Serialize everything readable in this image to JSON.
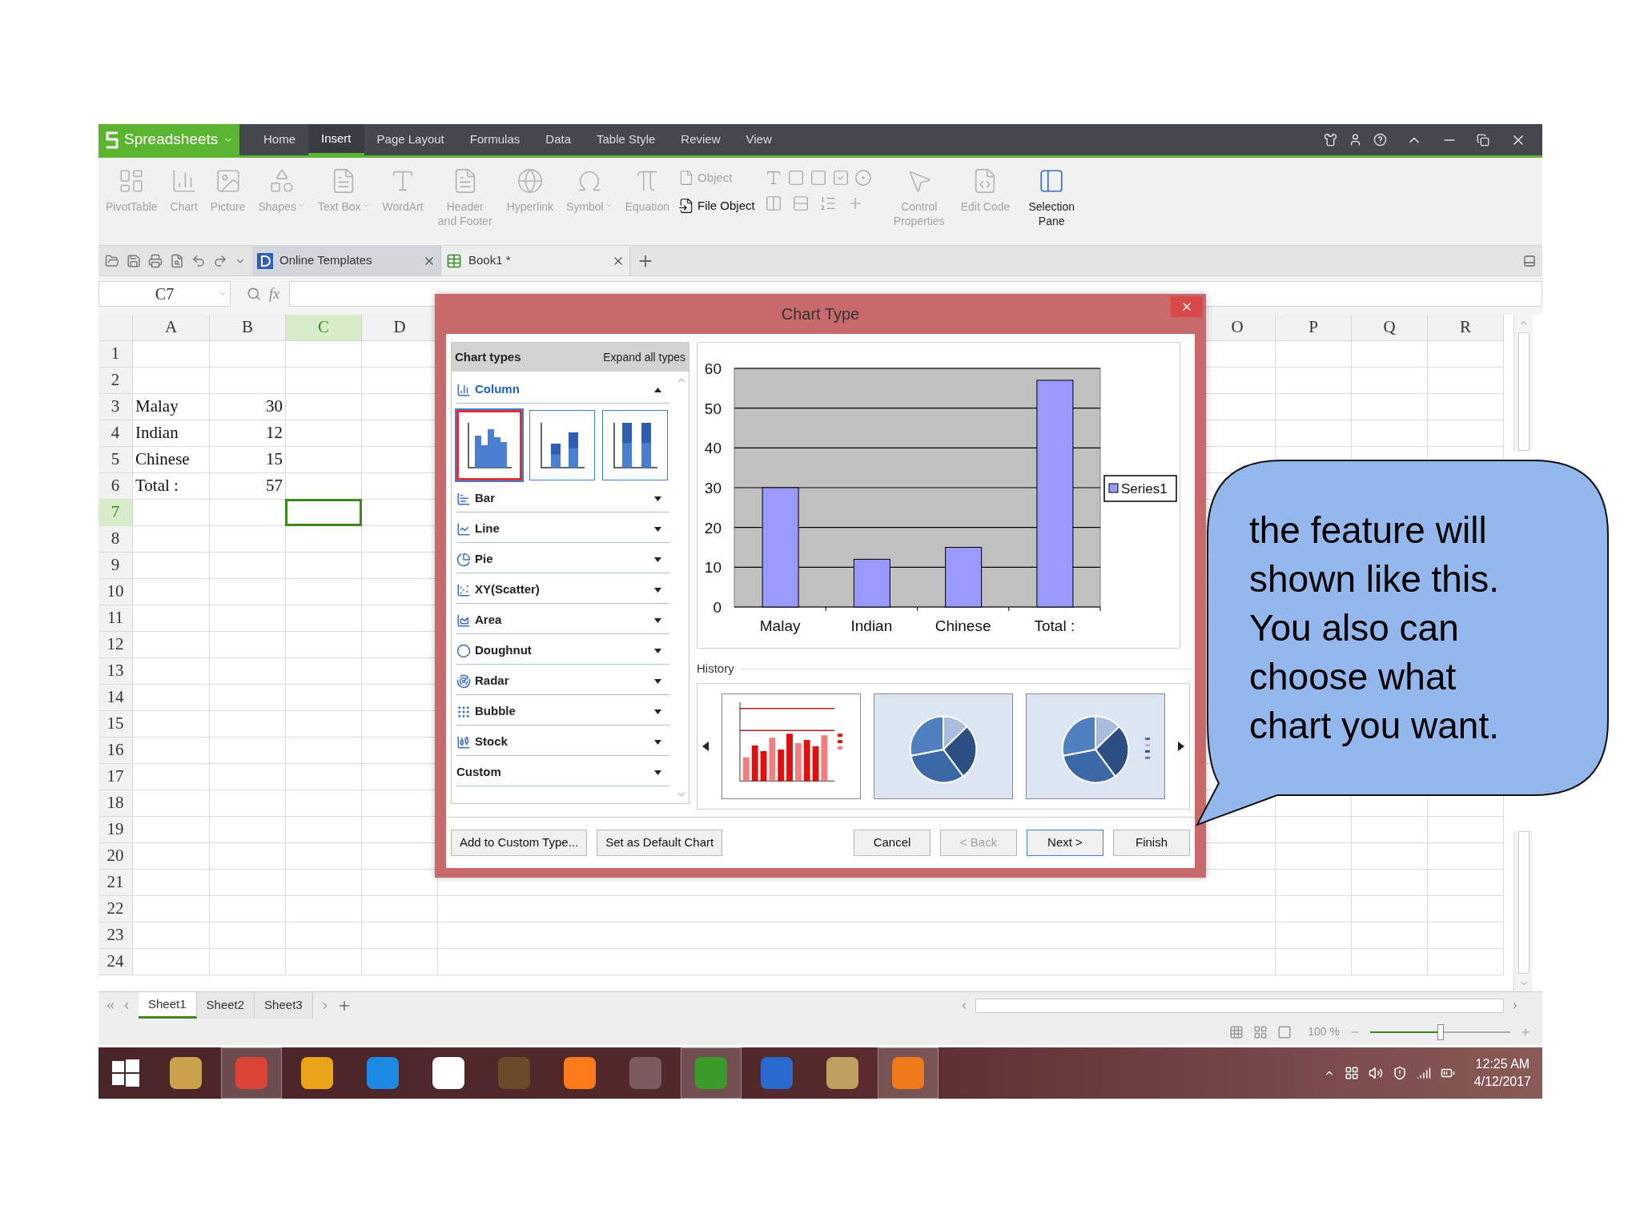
{
  "app": {
    "name": "Spreadsheets"
  },
  "menu_tabs": [
    {
      "label": "Home",
      "selected": false
    },
    {
      "label": "Insert",
      "selected": true
    },
    {
      "label": "Page Layout",
      "selected": false
    },
    {
      "label": "Formulas",
      "selected": false
    },
    {
      "label": "Data",
      "selected": false
    },
    {
      "label": "Table Style",
      "selected": false
    },
    {
      "label": "Review",
      "selected": false
    },
    {
      "label": "View",
      "selected": false
    }
  ],
  "ribbon": {
    "buttons": [
      {
        "label": "PivotTable",
        "disabled": true,
        "has_menu": false
      },
      {
        "label": "Chart",
        "disabled": true,
        "has_menu": false
      },
      {
        "label": "Picture",
        "disabled": true,
        "has_menu": false
      },
      {
        "label": "Shapes",
        "disabled": true,
        "has_menu": true
      },
      {
        "label": "Text Box",
        "disabled": true,
        "has_menu": true
      },
      {
        "label": "WordArt",
        "disabled": true,
        "has_menu": false
      },
      {
        "label": "Header and Footer",
        "disabled": true,
        "has_menu": false
      },
      {
        "label": "Hyperlink",
        "disabled": true,
        "has_menu": false
      },
      {
        "label": "Symbol",
        "disabled": true,
        "has_menu": true
      },
      {
        "label": "Equation",
        "disabled": true,
        "has_menu": false
      }
    ],
    "object_buttons": [
      {
        "label": "Object",
        "disabled": true
      },
      {
        "label": "File Object",
        "disabled": false
      }
    ],
    "control_buttons": [
      {
        "label": "Control Properties",
        "disabled": true
      },
      {
        "label": "Edit Code",
        "disabled": true
      },
      {
        "label": "Selection Pane",
        "disabled": false
      }
    ]
  },
  "doc_tabs": [
    {
      "label": "Online Templates",
      "selected": false
    },
    {
      "label": "Book1 *",
      "selected": true
    }
  ],
  "sheet": {
    "name_box": "C7",
    "formula_label": "fx",
    "columns": [
      {
        "label": "A",
        "selected": false
      },
      {
        "label": "B",
        "selected": false
      },
      {
        "label": "C",
        "selected": true
      },
      {
        "label": "D",
        "selected": false
      },
      {
        "label": "O",
        "selected": false
      },
      {
        "label": "P",
        "selected": false
      },
      {
        "label": "Q",
        "selected": false
      },
      {
        "label": "R",
        "selected": false
      }
    ],
    "rows": [
      {
        "header": "1",
        "selected": false
      },
      {
        "header": "2",
        "selected": false
      },
      {
        "header": "3",
        "selected": false,
        "cells": [
          "Malay",
          "30"
        ]
      },
      {
        "header": "4",
        "selected": false,
        "cells": [
          "Indian",
          "12"
        ]
      },
      {
        "header": "5",
        "selected": false,
        "cells": [
          "Chinese",
          "15"
        ]
      },
      {
        "header": "6",
        "selected": false,
        "cells": [
          "Total :",
          "57"
        ]
      },
      {
        "header": "7",
        "selected": true
      },
      {
        "header": "8",
        "selected": false
      },
      {
        "header": "9",
        "selected": false
      },
      {
        "header": "10",
        "selected": false
      },
      {
        "header": "11",
        "selected": false
      },
      {
        "header": "12",
        "selected": false
      },
      {
        "header": "13",
        "selected": false
      },
      {
        "header": "14",
        "selected": false
      },
      {
        "header": "15",
        "selected": false
      },
      {
        "header": "16",
        "selected": false
      },
      {
        "header": "17",
        "selected": false
      },
      {
        "header": "18",
        "selected": false
      },
      {
        "header": "19",
        "selected": false
      },
      {
        "header": "20",
        "selected": false
      },
      {
        "header": "21",
        "selected": false
      },
      {
        "header": "22",
        "selected": false
      },
      {
        "header": "23",
        "selected": false
      },
      {
        "header": "24",
        "selected": false
      }
    ]
  },
  "sheet_tabs": [
    {
      "label": "Sheet1",
      "selected": true
    },
    {
      "label": "Sheet2",
      "selected": false
    },
    {
      "label": "Sheet3",
      "selected": false
    }
  ],
  "zoom": {
    "label": "100 %",
    "level": 0.5
  },
  "taskbar": {
    "apps": [
      {
        "running": false
      },
      {
        "running": true
      },
      {
        "running": false
      },
      {
        "running": false
      },
      {
        "running": false
      },
      {
        "running": false
      },
      {
        "running": false
      },
      {
        "running": false
      },
      {
        "running": true
      },
      {
        "running": false
      },
      {
        "running": false
      },
      {
        "running": true
      }
    ],
    "time": "12:25 AM",
    "date": "4/12/2017"
  },
  "dialog": {
    "title": "Chart Type",
    "types_header": "Chart types",
    "expand_all": "Expand all types",
    "chart_types": [
      {
        "label": "Column",
        "expanded": true,
        "subtypes": [
          {
            "kind": "clustered",
            "selected": true
          },
          {
            "kind": "stacked",
            "selected": false
          },
          {
            "kind": "percent",
            "selected": false
          }
        ]
      },
      {
        "label": "Bar",
        "expanded": false
      },
      {
        "label": "Line",
        "expanded": false
      },
      {
        "label": "Pie",
        "expanded": false
      },
      {
        "label": "XY(Scatter)",
        "expanded": false
      },
      {
        "label": "Area",
        "expanded": false
      },
      {
        "label": "Doughnut",
        "expanded": false
      },
      {
        "label": "Radar",
        "expanded": false
      },
      {
        "label": "Bubble",
        "expanded": false
      },
      {
        "label": "Stock",
        "expanded": false
      },
      {
        "label": "Custom",
        "expanded": false
      }
    ],
    "preview": {
      "last_category_suffix": ":",
      "chart_data": {
        "type": "bar",
        "categories": [
          "Malay",
          "Indian",
          "Chinese",
          "Total"
        ],
        "series": [
          {
            "name": "Series1",
            "color": "#9999ff",
            "values": [
              30,
              12,
              15,
              57
            ]
          }
        ],
        "ylim": [
          0,
          60
        ],
        "grid": true,
        "yticks": [
          0,
          10,
          20,
          30,
          40,
          50,
          60
        ]
      }
    },
    "history": {
      "label": "History",
      "items": [
        {
          "kind": "bar"
        },
        {
          "kind": "pie"
        },
        {
          "kind": "pie_legend"
        }
      ]
    },
    "buttons": [
      {
        "label": "Add to Custom Type...",
        "disabled": false,
        "default": false
      },
      {
        "label": "Set as Default Chart",
        "disabled": false,
        "default": false
      },
      {
        "label": "Cancel",
        "disabled": false,
        "default": false
      },
      {
        "label": "< Back",
        "disabled": true,
        "default": false
      },
      {
        "label": "Next >",
        "disabled": false,
        "default": true
      },
      {
        "label": "Finish",
        "disabled": false,
        "default": false
      }
    ]
  },
  "callout": {
    "text": "the feature will\nshown like this.\nYou also can\nchoose what\nchart you want."
  }
}
